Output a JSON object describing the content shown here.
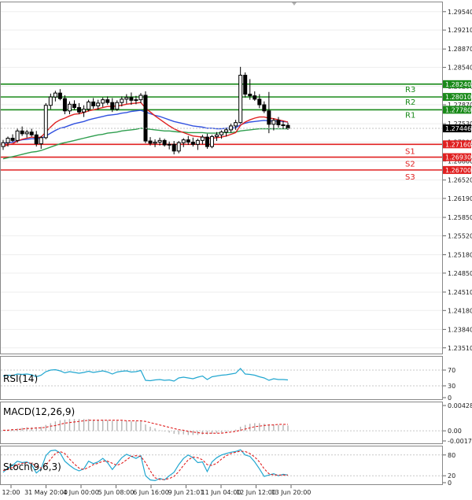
{
  "chart_data": [
    {
      "type": "candlestick",
      "instrument_note": "",
      "price_ticks": [
        "1.29540",
        "1.29210",
        "1.28870",
        "1.28540",
        "1.28200",
        "1.27870",
        "1.27530",
        "1.27200",
        "1.26860",
        "1.26520",
        "1.26190",
        "1.25850",
        "1.25520",
        "1.25180",
        "1.24850",
        "1.24510",
        "1.24180",
        "1.23840",
        "1.23510"
      ],
      "ylim": [
        1.2345,
        1.2965
      ],
      "levels": [
        {
          "name": "R3",
          "value": 1.2824,
          "label": "1.28240",
          "color": "#1a8a1a"
        },
        {
          "name": "R2",
          "value": 1.2801,
          "label": "1.28010",
          "color": "#1a8a1a"
        },
        {
          "name": "R1",
          "value": 1.2778,
          "label": "1.27780",
          "color": "#1a8a1a"
        },
        {
          "name": "S1",
          "value": 1.2716,
          "label": "1.27160",
          "color": "#e02020"
        },
        {
          "name": "S2",
          "value": 1.2693,
          "label": "1.26930",
          "color": "#e02020"
        },
        {
          "name": "S3",
          "value": 1.267,
          "label": "1.26700",
          "color": "#e02020"
        }
      ],
      "current_price": {
        "value": 1.27446,
        "label": "1.27446"
      },
      "time_labels": [
        "12:00",
        "31 May 20:00",
        "4 Jun 00:00",
        "5 Jun 08:00",
        "6 Jun 16:00",
        "9 Jun 21:01",
        "11 Jun 04:00",
        "12 Jun 12:00",
        "13 Jun 20:00"
      ],
      "ohlc": [
        [
          1.2712,
          1.2724,
          1.2706,
          1.2719
        ],
        [
          1.2719,
          1.273,
          1.2712,
          1.2727
        ],
        [
          1.2727,
          1.2734,
          1.272,
          1.2723
        ],
        [
          1.2723,
          1.2745,
          1.2719,
          1.274
        ],
        [
          1.274,
          1.2748,
          1.2731,
          1.2735
        ],
        [
          1.2735,
          1.2742,
          1.2728,
          1.2738
        ],
        [
          1.2738,
          1.2744,
          1.273,
          1.2733
        ],
        [
          1.2733,
          1.274,
          1.2712,
          1.2717
        ],
        [
          1.2717,
          1.2731,
          1.2708,
          1.2728
        ],
        [
          1.2728,
          1.279,
          1.2725,
          1.2786
        ],
        [
          1.2786,
          1.2807,
          1.2779,
          1.2801
        ],
        [
          1.2801,
          1.2812,
          1.2793,
          1.2808
        ],
        [
          1.2808,
          1.2815,
          1.2795,
          1.2798
        ],
        [
          1.2798,
          1.2804,
          1.277,
          1.2776
        ],
        [
          1.2776,
          1.2793,
          1.277,
          1.2788
        ],
        [
          1.2788,
          1.2795,
          1.2778,
          1.2782
        ],
        [
          1.2782,
          1.279,
          1.277,
          1.2774
        ],
        [
          1.2774,
          1.2786,
          1.2765,
          1.2779
        ],
        [
          1.2779,
          1.2796,
          1.2775,
          1.2792
        ],
        [
          1.2792,
          1.2799,
          1.278,
          1.2785
        ],
        [
          1.2785,
          1.2796,
          1.2778,
          1.279
        ],
        [
          1.279,
          1.28,
          1.2783,
          1.2796
        ],
        [
          1.2796,
          1.2802,
          1.2787,
          1.2791
        ],
        [
          1.2791,
          1.2799,
          1.2774,
          1.2779
        ],
        [
          1.2779,
          1.2795,
          1.2776,
          1.2791
        ],
        [
          1.2791,
          1.2802,
          1.2784,
          1.2797
        ],
        [
          1.2797,
          1.2806,
          1.2789,
          1.28
        ],
        [
          1.28,
          1.2809,
          1.2787,
          1.2795
        ],
        [
          1.2795,
          1.2803,
          1.2788,
          1.2796
        ],
        [
          1.2796,
          1.2808,
          1.279,
          1.2804
        ],
        [
          1.2804,
          1.2811,
          1.2718,
          1.2722
        ],
        [
          1.2722,
          1.2729,
          1.2714,
          1.2718
        ],
        [
          1.2718,
          1.2725,
          1.2711,
          1.272
        ],
        [
          1.272,
          1.2728,
          1.2714,
          1.2723
        ],
        [
          1.2723,
          1.2726,
          1.2712,
          1.2715
        ],
        [
          1.2715,
          1.2721,
          1.2707,
          1.2716
        ],
        [
          1.2716,
          1.2722,
          1.2698,
          1.2704
        ],
        [
          1.2704,
          1.2722,
          1.27,
          1.2719
        ],
        [
          1.2719,
          1.2727,
          1.2711,
          1.2724
        ],
        [
          1.2724,
          1.2731,
          1.2715,
          1.272
        ],
        [
          1.272,
          1.2728,
          1.2712,
          1.2716
        ],
        [
          1.2716,
          1.2726,
          1.2706,
          1.2723
        ],
        [
          1.2723,
          1.2733,
          1.2716,
          1.2729
        ],
        [
          1.2729,
          1.2735,
          1.2708,
          1.2712
        ],
        [
          1.2712,
          1.2733,
          1.2709,
          1.273
        ],
        [
          1.273,
          1.2738,
          1.2722,
          1.2733
        ],
        [
          1.2733,
          1.2741,
          1.2726,
          1.2738
        ],
        [
          1.2738,
          1.2745,
          1.273,
          1.2742
        ],
        [
          1.2742,
          1.2753,
          1.2737,
          1.2749
        ],
        [
          1.2749,
          1.276,
          1.2742,
          1.2755
        ],
        [
          1.2755,
          1.2855,
          1.2753,
          1.284
        ],
        [
          1.284,
          1.2845,
          1.28,
          1.2806
        ],
        [
          1.2806,
          1.2833,
          1.2796,
          1.2803
        ],
        [
          1.2803,
          1.2811,
          1.2794,
          1.2797
        ],
        [
          1.2797,
          1.2806,
          1.2781,
          1.2787
        ],
        [
          1.2787,
          1.2793,
          1.2772,
          1.2776
        ],
        [
          1.2776,
          1.281,
          1.2736,
          1.2752
        ],
        [
          1.2752,
          1.2763,
          1.2741,
          1.2759
        ],
        [
          1.2759,
          1.2765,
          1.2746,
          1.2751
        ],
        [
          1.2751,
          1.2758,
          1.2744,
          1.275
        ],
        [
          1.275,
          1.2755,
          1.2742,
          1.2745
        ]
      ],
      "ma_fast": {
        "color": "#e02020",
        "values": [
          1.2712,
          1.2715,
          1.2717,
          1.2722,
          1.2725,
          1.2727,
          1.2729,
          1.2728,
          1.2729,
          1.2738,
          1.2747,
          1.2755,
          1.276,
          1.2763,
          1.2767,
          1.277,
          1.2771,
          1.2773,
          1.2776,
          1.2778,
          1.278,
          1.2782,
          1.2784,
          1.2784,
          1.2785,
          1.2786,
          1.2788,
          1.2789,
          1.279,
          1.2791,
          1.2781,
          1.2774,
          1.2767,
          1.2761,
          1.2755,
          1.2749,
          1.2744,
          1.274,
          1.2737,
          1.2734,
          1.2731,
          1.273,
          1.2729,
          1.2727,
          1.2727,
          1.2728,
          1.2729,
          1.2731,
          1.2734,
          1.2737,
          1.275,
          1.2756,
          1.276,
          1.2763,
          1.2765,
          1.2765,
          1.2763,
          1.2762,
          1.276,
          1.2758,
          1.2756
        ]
      },
      "ma_mid": {
        "color": "#3050e0",
        "values": [
          1.2718,
          1.2719,
          1.272,
          1.2722,
          1.2724,
          1.2725,
          1.2726,
          1.2726,
          1.2727,
          1.2731,
          1.2736,
          1.2741,
          1.2745,
          1.2747,
          1.275,
          1.2753,
          1.2755,
          1.2757,
          1.276,
          1.2762,
          1.2764,
          1.2766,
          1.2768,
          1.2769,
          1.277,
          1.2772,
          1.2773,
          1.2775,
          1.2776,
          1.2777,
          1.2774,
          1.2771,
          1.2768,
          1.2766,
          1.2763,
          1.276,
          1.2757,
          1.2755,
          1.2753,
          1.2751,
          1.2749,
          1.2748,
          1.2747,
          1.2745,
          1.2745,
          1.2744,
          1.2744,
          1.2745,
          1.2745,
          1.2746,
          1.2751,
          1.2754,
          1.2756,
          1.2757,
          1.2758,
          1.2759,
          1.2758,
          1.2758,
          1.2758,
          1.2757,
          1.2756
        ]
      },
      "ma_slow": {
        "color": "#2e9e4e",
        "values": [
          1.269,
          1.2692,
          1.2694,
          1.2696,
          1.2698,
          1.27,
          1.2702,
          1.2703,
          1.2705,
          1.2708,
          1.2711,
          1.2714,
          1.2717,
          1.2719,
          1.2721,
          1.2723,
          1.2725,
          1.2727,
          1.2729,
          1.2731,
          1.2733,
          1.2734,
          1.2736,
          1.2737,
          1.2738,
          1.274,
          1.2741,
          1.2742,
          1.2743,
          1.2745,
          1.2744,
          1.2743,
          1.2742,
          1.2741,
          1.274,
          1.274,
          1.2739,
          1.2738,
          1.2738,
          1.2737,
          1.2737,
          1.2737,
          1.2737,
          1.2736,
          1.2736,
          1.2736,
          1.2737,
          1.2737,
          1.2737,
          1.2738,
          1.274,
          1.2741,
          1.2742,
          1.2743,
          1.2744,
          1.2744,
          1.2744,
          1.2744,
          1.2744,
          1.2744,
          1.2744
        ]
      }
    },
    {
      "type": "line",
      "title": "RSI(14)",
      "y_ticks": [
        "70",
        "30",
        "0"
      ],
      "ylim": [
        0,
        100
      ],
      "levels": [
        70,
        30
      ],
      "color": "#22a7d0",
      "values": [
        55,
        57,
        56,
        60,
        59,
        60,
        58,
        53,
        57,
        66,
        70,
        71,
        68,
        63,
        66,
        64,
        62,
        64,
        67,
        64,
        66,
        68,
        65,
        60,
        65,
        67,
        68,
        65,
        66,
        69,
        44,
        43,
        45,
        46,
        44,
        45,
        42,
        50,
        52,
        50,
        48,
        52,
        55,
        46,
        53,
        55,
        57,
        58,
        60,
        62,
        74,
        60,
        59,
        57,
        53,
        50,
        44,
        48,
        46,
        46,
        45
      ]
    },
    {
      "type": "histogram+line",
      "title": "MACD(12,26,9)",
      "y_ticks": [
        "0.004289",
        "0.00",
        "-0.001713"
      ],
      "ylim": [
        -0.001713,
        0.004289
      ],
      "hist_color": "#b4b4b4",
      "signal_color": "#e02020",
      "hist": [
        0.0001,
        0.0002,
        0.0003,
        0.0004,
        0.0005,
        0.0006,
        0.0006,
        0.0006,
        0.0007,
        0.001,
        0.0013,
        0.0016,
        0.0018,
        0.0019,
        0.002,
        0.002,
        0.002,
        0.002,
        0.002,
        0.0019,
        0.0019,
        0.0019,
        0.0018,
        0.0017,
        0.0017,
        0.0017,
        0.0017,
        0.0016,
        0.0016,
        0.0016,
        0.0011,
        0.0007,
        0.0004,
        0.0001,
        -0.0001,
        -0.0003,
        -0.0005,
        -0.0006,
        -0.0006,
        -0.0007,
        -0.0007,
        -0.0007,
        -0.0006,
        -0.0006,
        -0.0005,
        -0.0004,
        -0.0003,
        -0.0002,
        0.0,
        0.0002,
        0.0007,
        0.001,
        0.0012,
        0.0013,
        0.0013,
        0.0012,
        0.0011,
        0.0011,
        0.001,
        0.001,
        0.0009
      ],
      "signal": [
        0.0001,
        0.0001,
        0.0002,
        0.0002,
        0.0003,
        0.0004,
        0.0004,
        0.0005,
        0.0005,
        0.0006,
        0.0008,
        0.0009,
        0.0011,
        0.0013,
        0.0014,
        0.0015,
        0.0016,
        0.0017,
        0.0018,
        0.0018,
        0.0018,
        0.0018,
        0.0018,
        0.0018,
        0.0018,
        0.0018,
        0.0017,
        0.0017,
        0.0017,
        0.0017,
        0.0016,
        0.0014,
        0.0012,
        0.001,
        0.0008,
        0.0006,
        0.0004,
        0.0002,
        0.0001,
        -0.0001,
        -0.0002,
        -0.0003,
        -0.0004,
        -0.0004,
        -0.0004,
        -0.0004,
        -0.0004,
        -0.0003,
        -0.0002,
        -0.0001,
        0.0001,
        0.0003,
        0.0005,
        0.0007,
        0.0008,
        0.0009,
        0.001,
        0.001,
        0.0011,
        0.0011,
        0.0011
      ]
    },
    {
      "type": "line",
      "title": "Stoch(9,6,3)",
      "y_ticks": [
        "80",
        "20",
        "0"
      ],
      "ylim": [
        0,
        100
      ],
      "levels": [
        80,
        20
      ],
      "main_color": "#22a7d0",
      "signal_color": "#e02020",
      "main": [
        30,
        42,
        50,
        62,
        58,
        60,
        52,
        28,
        40,
        78,
        92,
        94,
        86,
        62,
        50,
        40,
        34,
        40,
        62,
        55,
        60,
        70,
        58,
        38,
        55,
        72,
        82,
        76,
        70,
        78,
        20,
        8,
        6,
        12,
        8,
        20,
        30,
        52,
        70,
        80,
        72,
        58,
        60,
        32,
        60,
        72,
        80,
        84,
        88,
        90,
        95,
        80,
        76,
        60,
        40,
        18,
        22,
        26,
        20,
        24,
        22
      ],
      "signal": [
        35,
        38,
        44,
        52,
        56,
        58,
        56,
        48,
        42,
        50,
        68,
        84,
        90,
        84,
        68,
        54,
        42,
        38,
        44,
        52,
        56,
        62,
        62,
        56,
        50,
        56,
        66,
        76,
        78,
        76,
        58,
        34,
        14,
        9,
        9,
        12,
        18,
        32,
        50,
        66,
        74,
        72,
        66,
        52,
        50,
        56,
        68,
        78,
        84,
        88,
        91,
        90,
        84,
        74,
        60,
        40,
        26,
        22,
        22,
        22,
        22
      ]
    }
  ]
}
